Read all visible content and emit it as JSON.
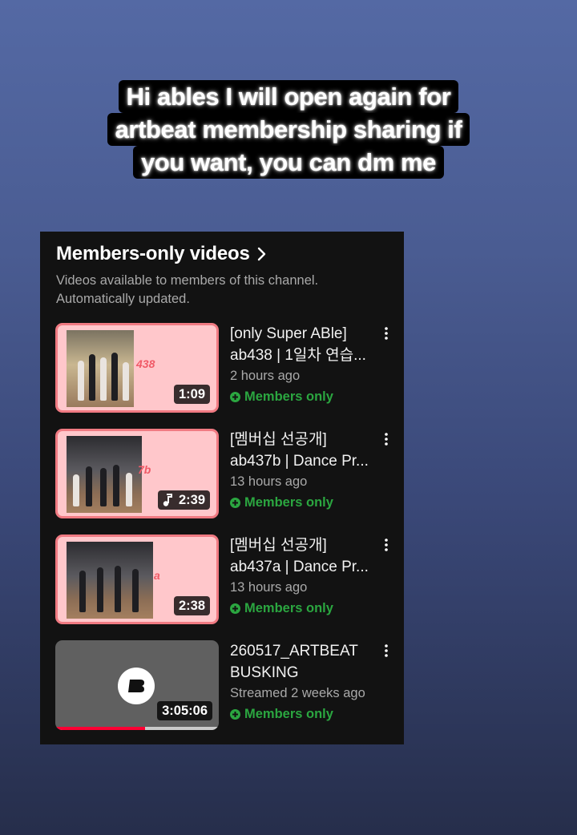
{
  "caption": {
    "lines": [
      "Hi ables I will open again for",
      "artbeat membership sharing if",
      "you want, you can dm me"
    ]
  },
  "section": {
    "title": "Members-only videos",
    "description_lines": [
      "Videos available to members of this channel.",
      "Automatically updated."
    ]
  },
  "videos": [
    {
      "title_lines": [
        "[only Super ABle]",
        "ab438 | 1일차 연습..."
      ],
      "meta": "2 hours ago",
      "duration": "1:09",
      "badge": "Members only",
      "thumb_tag": "438"
    },
    {
      "title_lines": [
        "[멤버십 선공개]",
        "ab437b | Dance Pr..."
      ],
      "meta": "13 hours ago",
      "duration": "2:39",
      "badge": "Members only",
      "thumb_tag": "7b"
    },
    {
      "title_lines": [
        "[멤버십 선공개]",
        "ab437a | Dance Pr..."
      ],
      "meta": "13 hours ago",
      "duration": "2:38",
      "badge": "Members only",
      "thumb_tag": "a"
    },
    {
      "title_lines": [
        "260517_ARTBEAT",
        "BUSKING"
      ],
      "meta": "Streamed 2 weeks ago",
      "duration": "3:05:06",
      "badge": "Members only",
      "watched_fraction": 0.55
    }
  ],
  "colors": {
    "members_green": "#2ba640",
    "thumb_pink": "#ffc7cb",
    "thumb_border": "#f07a82",
    "progress_red": "#ff0033"
  },
  "icons": {
    "section_arrow": "chevron-right-icon",
    "more": "kebab-menu-icon",
    "member_badge": "members-plus-icon",
    "audio": "music-note-icon"
  }
}
